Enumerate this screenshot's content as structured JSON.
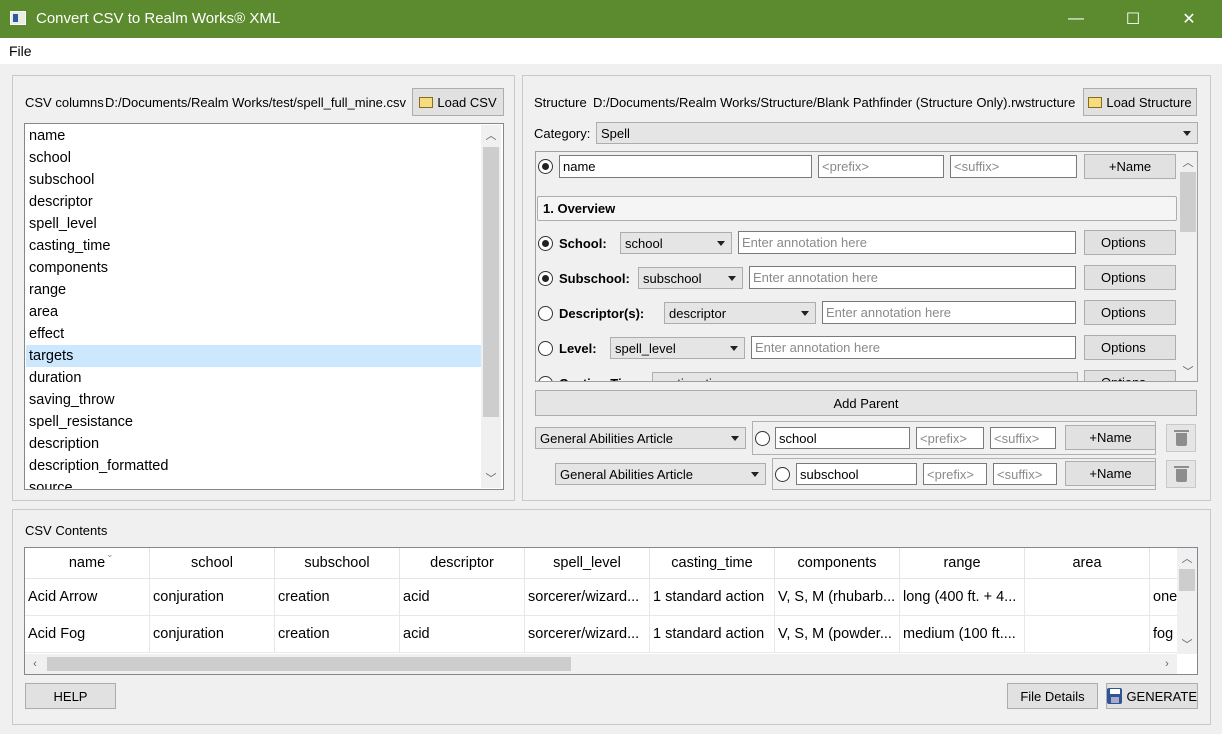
{
  "window": {
    "title": "Convert CSV to Realm Works® XML",
    "minimize": "—",
    "maximize": "☐",
    "close": "✕"
  },
  "menu": [
    "File"
  ],
  "csv_panel": {
    "label": "CSV columns",
    "path": "D:/Documents/Realm Works/test/spell_full_mine.csv",
    "load_button": "Load CSV",
    "columns": [
      "name",
      "school",
      "subschool",
      "descriptor",
      "spell_level",
      "casting_time",
      "components",
      "range",
      "area",
      "effect",
      "targets",
      "duration",
      "saving_throw",
      "spell_resistance",
      "description",
      "description_formatted",
      "source"
    ],
    "selected": "targets"
  },
  "structure_panel": {
    "label": "Structure",
    "path": "D:/Documents/Realm Works/Structure/Blank Pathfinder (Structure Only).rwstructure",
    "load_button": "Load Structure",
    "category_label": "Category:",
    "category_value": "Spell",
    "name_row": {
      "value": "name",
      "prefix_placeholder": "<prefix>",
      "suffix_placeholder": "<suffix>",
      "button": "+Name"
    },
    "section_header": "1.  Overview",
    "fields": [
      {
        "label": "School:",
        "value": "school",
        "placeholder": "Enter annotation here",
        "options": "Options",
        "selected": true
      },
      {
        "label": "Subschool:",
        "value": "subschool",
        "placeholder": "Enter annotation here",
        "options": "Options",
        "selected": true
      },
      {
        "label": "Descriptor(s):",
        "value": "descriptor",
        "placeholder": "Enter annotation here",
        "options": "Options",
        "selected": false
      },
      {
        "label": "Level:",
        "value": "spell_level",
        "placeholder": "Enter annotation here",
        "options": "Options",
        "selected": false
      },
      {
        "label": "Casting Time:",
        "value": "casting_time",
        "placeholder": "",
        "options": "Options",
        "selected": false
      }
    ],
    "add_parent_button": "Add Parent",
    "parents": [
      {
        "category": "General Abilities Article",
        "value": "school",
        "prefix_placeholder": "<prefix>",
        "suffix_placeholder": "<suffix>",
        "button": "+Name"
      },
      {
        "category": "General Abilities Article",
        "value": "subschool",
        "prefix_placeholder": "<prefix>",
        "suffix_placeholder": "<suffix>",
        "button": "+Name"
      }
    ]
  },
  "csv_contents": {
    "label": "CSV Contents",
    "headers": [
      "name",
      "school",
      "subschool",
      "descriptor",
      "spell_level",
      "casting_time",
      "components",
      "range",
      "area",
      ""
    ],
    "rows": [
      [
        "Acid Arrow",
        "conjuration",
        "creation",
        "acid",
        "sorcerer/wizard...",
        "1 standard action",
        "V, S, M (rhubarb...",
        "long (400 ft. + 4...",
        "",
        "one"
      ],
      [
        "Acid Fog",
        "conjuration",
        "creation",
        "acid",
        "sorcerer/wizard...",
        "1 standard action",
        "V, S, M (powder...",
        "medium (100 ft....",
        "",
        "fog"
      ]
    ]
  },
  "bottom": {
    "help": "HELP",
    "file_details": "File Details",
    "generate": "GENERATE"
  },
  "icons": {
    "folder": "folder-open-icon",
    "save": "floppy-disk-icon",
    "trash": "trash-icon"
  },
  "colors": {
    "titlebar": "#5c8a2e",
    "selection": "#cce8ff"
  }
}
